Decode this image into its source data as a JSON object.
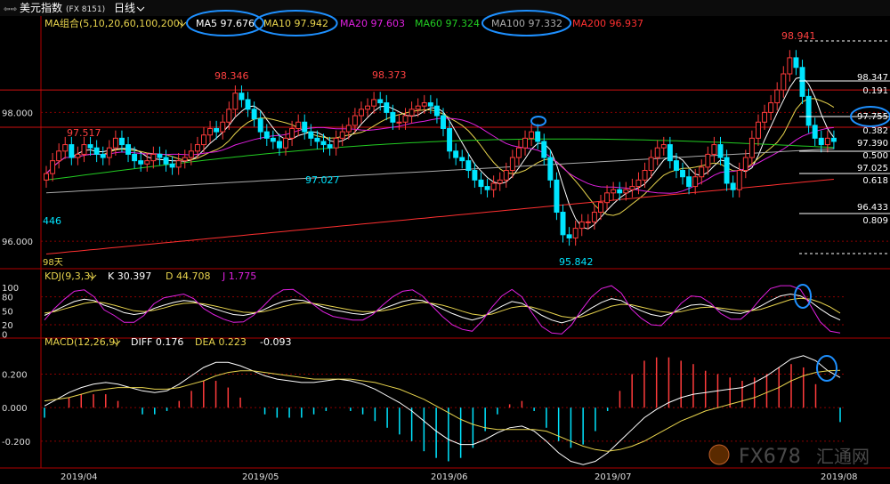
{
  "window": {
    "title": "美元指数",
    "code": "(FX 8151)",
    "period": "日线"
  },
  "indicators": {
    "ma": {
      "label": "MA组合(5,10,20,60,100,200)",
      "items": [
        {
          "name": "MA5",
          "value": "97.676",
          "color": "#ffffff",
          "circled": true
        },
        {
          "name": "MA10",
          "value": "97.942",
          "color": "#e8d44d",
          "circled": true
        },
        {
          "name": "MA20",
          "value": "97.603",
          "color": "#e020e0",
          "circled": false
        },
        {
          "name": "MA60",
          "value": "97.324",
          "color": "#22cc22",
          "circled": false
        },
        {
          "name": "MA100",
          "value": "97.332",
          "color": "#aaaaaa",
          "circled": true
        },
        {
          "name": "MA200",
          "value": "96.937",
          "color": "#ff3030",
          "circled": false
        }
      ]
    },
    "kdj": {
      "label": "KDJ(9,3,3)",
      "k": "K 30.397",
      "d": "D 44.708",
      "j": "J 1.775"
    },
    "macd": {
      "label": "MACD(12,26,9)",
      "diff": "DIFF 0.176",
      "dea": "DEA 0.223",
      "macd": "-0.093"
    }
  },
  "chart_data": [
    {
      "type": "candlestick",
      "title": "美元指数",
      "y_ticks": [
        "98.000",
        "96.000"
      ],
      "ylim": [
        95.6,
        99.25
      ],
      "x_tick_labels": [
        "2019/04",
        "2019/05",
        "2019/06",
        "2019/07",
        "2019/08"
      ],
      "annotations": [
        "97.517",
        "98.346",
        "98.373",
        "98.941",
        "97.027",
        "95.842",
        "446",
        "98天"
      ],
      "right_labels": [
        "98.347",
        "0.191",
        "97.755",
        "0.382",
        "97.390",
        "0.500",
        "97.025",
        "0.618",
        "96.433",
        "0.809"
      ],
      "close": [
        97.05,
        97.25,
        97.4,
        97.5,
        97.3,
        97.35,
        97.5,
        97.45,
        97.35,
        97.3,
        97.45,
        97.6,
        97.5,
        97.35,
        97.25,
        97.2,
        97.25,
        97.35,
        97.3,
        97.2,
        97.15,
        97.25,
        97.3,
        97.4,
        97.5,
        97.65,
        97.75,
        97.7,
        97.85,
        98.05,
        98.3,
        98.2,
        98.05,
        97.9,
        97.7,
        97.6,
        97.55,
        97.45,
        97.6,
        97.75,
        97.85,
        97.7,
        97.6,
        97.55,
        97.5,
        97.45,
        97.6,
        97.7,
        97.8,
        97.95,
        98.05,
        98.1,
        98.2,
        98.15,
        98.0,
        97.85,
        97.85,
        97.95,
        98.05,
        98.1,
        98.15,
        98.1,
        97.95,
        97.75,
        97.4,
        97.3,
        97.25,
        97.1,
        96.95,
        96.85,
        96.8,
        96.9,
        96.95,
        97.1,
        97.3,
        97.45,
        97.6,
        97.7,
        97.55,
        97.3,
        96.95,
        96.45,
        96.1,
        96.05,
        96.2,
        96.3,
        96.3,
        96.45,
        96.6,
        96.75,
        96.8,
        96.75,
        96.8,
        96.85,
        96.95,
        97.1,
        97.3,
        97.45,
        97.5,
        97.25,
        97.1,
        97.0,
        96.85,
        97.0,
        97.15,
        97.35,
        97.5,
        97.3,
        96.9,
        96.8,
        97.1,
        97.3,
        97.6,
        97.85,
        98.0,
        98.15,
        98.35,
        98.6,
        98.85,
        98.7,
        98.25,
        97.8,
        97.6,
        97.5,
        97.6,
        97.55
      ]
    },
    {
      "type": "line",
      "title": "KDJ(9,3,3)",
      "y_ticks": [
        "100",
        "80",
        "50",
        "20",
        "0"
      ],
      "ylim": [
        -5,
        110
      ],
      "series": [
        {
          "name": "K",
          "color": "#ffffff",
          "values": [
            40,
            50,
            60,
            70,
            75,
            72,
            62,
            55,
            46,
            42,
            45,
            55,
            62,
            68,
            72,
            70,
            62,
            55,
            48,
            42,
            40,
            44,
            52,
            62,
            70,
            74,
            72,
            66,
            58,
            52,
            48,
            44,
            42,
            46,
            54,
            62,
            70,
            74,
            72,
            64,
            54,
            44,
            36,
            30,
            36,
            48,
            60,
            70,
            66,
            54,
            40,
            30,
            24,
            30,
            42,
            56,
            68,
            76,
            72,
            60,
            50,
            42,
            38,
            44,
            54,
            62,
            64,
            60,
            52,
            46,
            44,
            50,
            60,
            72,
            82,
            86,
            82,
            70,
            54,
            40,
            30
          ]
        },
        {
          "name": "D",
          "color": "#e8d44d",
          "values": [
            45,
            48,
            54,
            60,
            66,
            69,
            67,
            62,
            56,
            50,
            48,
            51,
            56,
            62,
            66,
            67,
            65,
            61,
            56,
            51,
            47,
            46,
            48,
            53,
            59,
            64,
            67,
            66,
            63,
            59,
            55,
            51,
            48,
            48,
            50,
            54,
            60,
            65,
            68,
            66,
            62,
            56,
            49,
            43,
            40,
            43,
            50,
            57,
            60,
            58,
            52,
            45,
            38,
            35,
            37,
            44,
            52,
            60,
            64,
            63,
            58,
            53,
            48,
            46,
            48,
            53,
            57,
            58,
            56,
            53,
            50,
            50,
            53,
            60,
            67,
            74,
            77,
            75,
            68,
            58,
            45
          ]
        },
        {
          "name": "J",
          "color": "#e020e0",
          "values": [
            30,
            55,
            75,
            92,
            95,
            80,
            52,
            40,
            25,
            25,
            40,
            65,
            78,
            82,
            86,
            76,
            55,
            42,
            32,
            25,
            26,
            40,
            60,
            82,
            95,
            96,
            82,
            64,
            48,
            38,
            34,
            30,
            30,
            42,
            62,
            80,
            92,
            95,
            82,
            60,
            38,
            20,
            10,
            6,
            28,
            58,
            82,
            96,
            80,
            46,
            16,
            2,
            0,
            20,
            52,
            80,
            98,
            104,
            88,
            54,
            34,
            20,
            18,
            40,
            66,
            82,
            80,
            66,
            44,
            32,
            32,
            50,
            76,
            98,
            104,
            104,
            96,
            62,
            26,
            6,
            2
          ]
        }
      ]
    },
    {
      "type": "bar+line",
      "title": "MACD(12,26,9)",
      "y_ticks": [
        "0.200",
        "0.000",
        "-0.200"
      ],
      "ylim": [
        -0.36,
        0.33
      ],
      "series": [
        {
          "name": "DIFF",
          "color": "#ffffff",
          "values": [
            0.01,
            0.05,
            0.09,
            0.12,
            0.14,
            0.15,
            0.14,
            0.12,
            0.1,
            0.09,
            0.1,
            0.14,
            0.19,
            0.24,
            0.27,
            0.27,
            0.25,
            0.22,
            0.19,
            0.17,
            0.16,
            0.15,
            0.15,
            0.16,
            0.17,
            0.16,
            0.14,
            0.11,
            0.07,
            0.03,
            -0.02,
            -0.08,
            -0.14,
            -0.19,
            -0.22,
            -0.22,
            -0.19,
            -0.15,
            -0.12,
            -0.11,
            -0.14,
            -0.2,
            -0.27,
            -0.32,
            -0.34,
            -0.32,
            -0.27,
            -0.2,
            -0.13,
            -0.06,
            -0.01,
            0.03,
            0.06,
            0.08,
            0.09,
            0.1,
            0.11,
            0.12,
            0.15,
            0.19,
            0.24,
            0.29,
            0.31,
            0.28,
            0.22,
            0.18
          ]
        },
        {
          "name": "DEA",
          "color": "#e8d44d",
          "values": [
            0.04,
            0.05,
            0.06,
            0.08,
            0.1,
            0.11,
            0.12,
            0.12,
            0.12,
            0.11,
            0.11,
            0.12,
            0.14,
            0.16,
            0.19,
            0.21,
            0.22,
            0.22,
            0.21,
            0.2,
            0.19,
            0.18,
            0.17,
            0.17,
            0.17,
            0.17,
            0.16,
            0.15,
            0.13,
            0.11,
            0.08,
            0.05,
            0.01,
            -0.03,
            -0.07,
            -0.1,
            -0.12,
            -0.13,
            -0.13,
            -0.13,
            -0.13,
            -0.14,
            -0.17,
            -0.2,
            -0.23,
            -0.25,
            -0.26,
            -0.25,
            -0.23,
            -0.2,
            -0.16,
            -0.12,
            -0.08,
            -0.05,
            -0.02,
            0.0,
            0.02,
            0.04,
            0.06,
            0.09,
            0.12,
            0.16,
            0.19,
            0.21,
            0.22,
            0.223
          ]
        }
      ]
    }
  ],
  "watermark": {
    "logo": "FX678",
    "text": "汇通网"
  },
  "colors": {
    "up": "#ff3b3b",
    "down": "#00e5ff",
    "grid": "#8b0000",
    "axis": "#b00000",
    "highlight": "#1e90ff"
  }
}
